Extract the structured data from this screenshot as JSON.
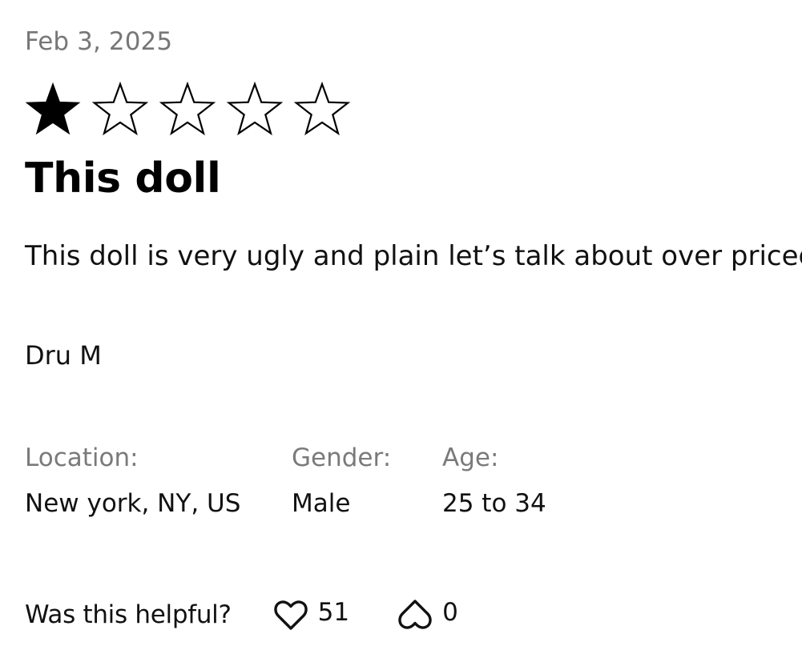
{
  "review": {
    "date": "Feb 3, 2025",
    "rating": {
      "value": 1,
      "max": 5
    },
    "title": "This doll",
    "body": "This doll is very ugly and plain let’s talk about over priced",
    "author": "Dru M",
    "attributes": {
      "location": {
        "label": "Location:",
        "value": "New york, NY, US"
      },
      "gender": {
        "label": "Gender:",
        "value": "Male"
      },
      "age": {
        "label": "Age:",
        "value": "25 to 34"
      }
    },
    "helpful": {
      "question": "Was this helpful?",
      "up": {
        "icon": "heart-icon",
        "count": "51"
      },
      "down": {
        "icon": "upside-down-heart-icon",
        "count": "0"
      }
    }
  },
  "colors": {
    "text": "#111111",
    "muted": "#777777",
    "star": "#000000"
  }
}
